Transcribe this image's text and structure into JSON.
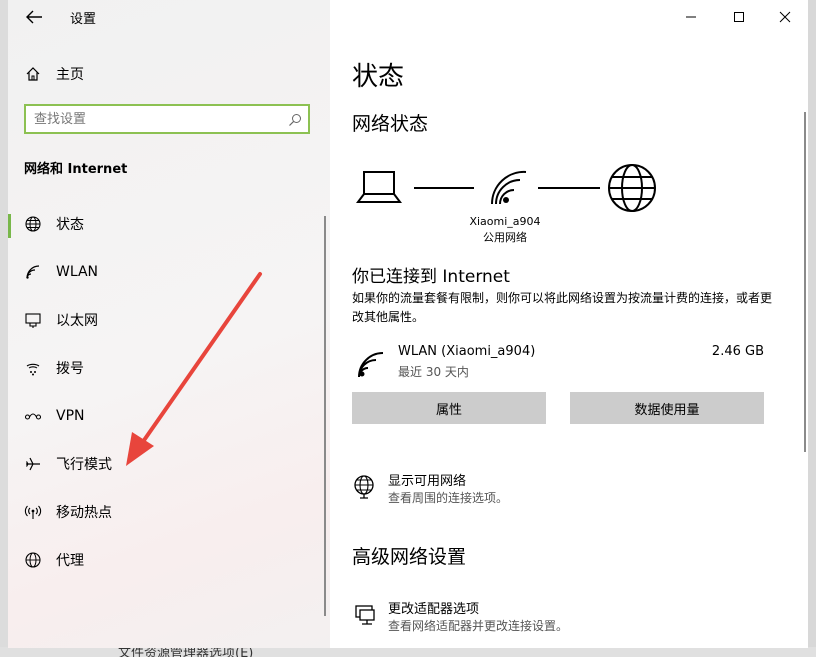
{
  "window": {
    "title": "设置",
    "controls": {
      "minimize": "minimize",
      "maximize": "maximize",
      "close": "close"
    }
  },
  "sidebar": {
    "home_label": "主页",
    "search_placeholder": "查找设置",
    "section_title": "网络和 Internet",
    "items": [
      {
        "label": "状态",
        "icon": "globe-status-icon",
        "active": true
      },
      {
        "label": "WLAN",
        "icon": "wifi-icon"
      },
      {
        "label": "以太网",
        "icon": "ethernet-icon"
      },
      {
        "label": "拨号",
        "icon": "dialup-icon"
      },
      {
        "label": "VPN",
        "icon": "vpn-icon"
      },
      {
        "label": "飞行模式",
        "icon": "airplane-icon"
      },
      {
        "label": "移动热点",
        "icon": "hotspot-icon"
      },
      {
        "label": "代理",
        "icon": "globe-icon"
      }
    ]
  },
  "main": {
    "page_title": "状态",
    "network_status_heading": "网络状态",
    "network_name": "Xiaomi_a904",
    "network_type": "公用网络",
    "connected_heading": "你已连接到 Internet",
    "connected_desc": "如果你的流量套餐有限制，则你可以将此网络设置为按流量计费的连接，或者更改其他属性。",
    "connection": {
      "name": "WLAN (Xiaomi_a904)",
      "period": "最近 30 天内",
      "usage": "2.46 GB"
    },
    "buttons": {
      "properties": "属性",
      "data_usage": "数据使用量"
    },
    "show_networks": {
      "title": "显示可用网络",
      "subtitle": "查看周围的连接选项。"
    },
    "advanced_heading": "高级网络设置",
    "adapter_options": {
      "title": "更改适配器选项",
      "subtitle": "查看网络适配器并更改连接设置。"
    }
  },
  "background_app": {
    "bottom_text": "文件资源管理器选项(E)"
  },
  "colors": {
    "accent_green": "#78b74a",
    "search_border": "#8cc152",
    "annotation_red": "#e8453c",
    "button_gray": "#cccccc"
  }
}
